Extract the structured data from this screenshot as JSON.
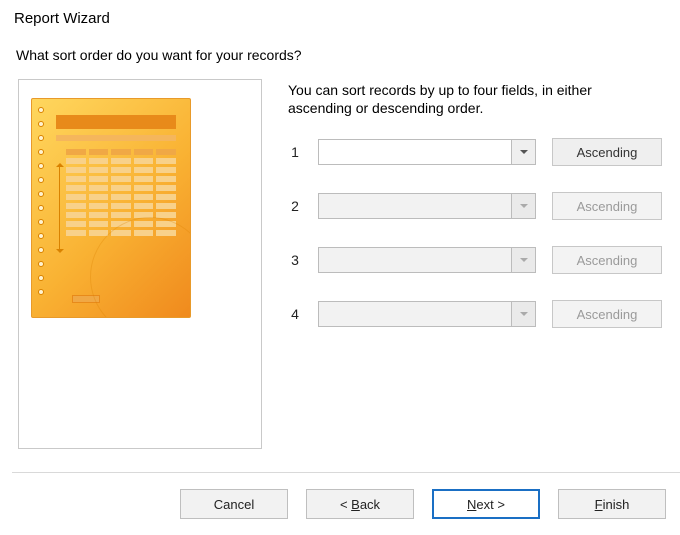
{
  "title": "Report Wizard",
  "question": "What sort order do you want for your records?",
  "instruction_line1": "You can sort records by up to four fields, in either",
  "instruction_line2": "ascending or descending order.",
  "rows": [
    {
      "num": "1",
      "value": "",
      "order": "Ascending",
      "enabled": true
    },
    {
      "num": "2",
      "value": "",
      "order": "Ascending",
      "enabled": false
    },
    {
      "num": "3",
      "value": "",
      "order": "Ascending",
      "enabled": false
    },
    {
      "num": "4",
      "value": "",
      "order": "Ascending",
      "enabled": false
    }
  ],
  "buttons": {
    "cancel": "Cancel",
    "back_prefix": "< ",
    "back_u": "B",
    "back_rest": "ack",
    "next_u": "N",
    "next_rest": "ext >",
    "finish_u": "F",
    "finish_rest": "inish"
  }
}
